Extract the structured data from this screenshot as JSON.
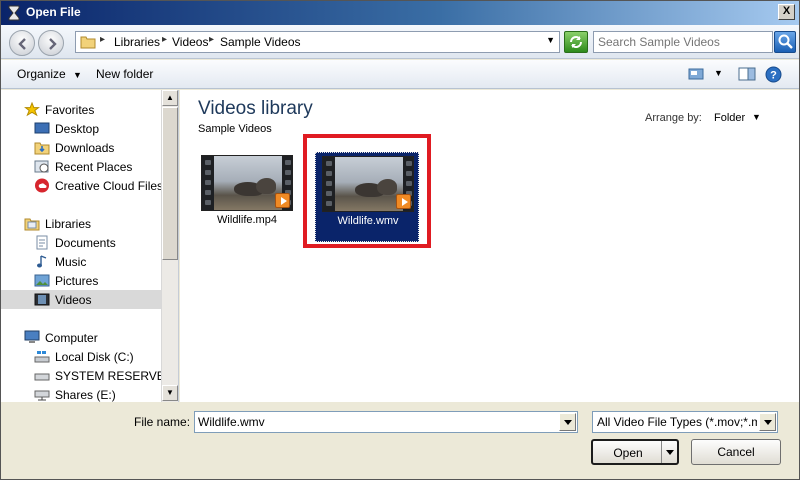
{
  "window": {
    "title": "Open File",
    "close_glyph": "X"
  },
  "address": {
    "crumbs": [
      "Libraries",
      "Videos",
      "Sample Videos"
    ],
    "search_placeholder": "Search Sample Videos"
  },
  "toolbar": {
    "organize_label": "Organize",
    "new_folder_label": "New folder"
  },
  "nav": {
    "favorites_label": "Favorites",
    "favorites": [
      {
        "label": "Desktop",
        "icon": "desktop-icon"
      },
      {
        "label": "Downloads",
        "icon": "downloads-icon"
      },
      {
        "label": "Recent Places",
        "icon": "recent-places-icon"
      },
      {
        "label": "Creative Cloud Files",
        "icon": "creative-cloud-icon"
      }
    ],
    "libraries_label": "Libraries",
    "libraries": [
      {
        "label": "Documents",
        "icon": "documents-icon"
      },
      {
        "label": "Music",
        "icon": "music-icon"
      },
      {
        "label": "Pictures",
        "icon": "pictures-icon"
      },
      {
        "label": "Videos",
        "icon": "videos-icon",
        "selected": true
      }
    ],
    "computer_label": "Computer",
    "drives": [
      {
        "label": "Local Disk (C:)",
        "icon": "local-disk-icon"
      },
      {
        "label": "SYSTEM RESERVED (D",
        "icon": "drive-icon"
      },
      {
        "label": "Shares (E:)",
        "icon": "network-drive-icon"
      }
    ]
  },
  "content": {
    "library_title": "Videos library",
    "library_subtitle": "Sample Videos",
    "arrange_label": "Arrange by:",
    "arrange_value": "Folder",
    "files": [
      {
        "name": "Wildlife.mp4",
        "selected": false
      },
      {
        "name": "Wildlife.wmv",
        "selected": true
      }
    ]
  },
  "bottom": {
    "file_name_label": "File name:",
    "file_name_value": "Wildlife.wmv",
    "file_type_value": "All Video File Types (*.mov;*.mp",
    "open_label": "Open",
    "cancel_label": "Cancel"
  },
  "colors": {
    "highlight": "#e01b22",
    "selection": "#0a246a",
    "title_text": "#1e395b"
  }
}
